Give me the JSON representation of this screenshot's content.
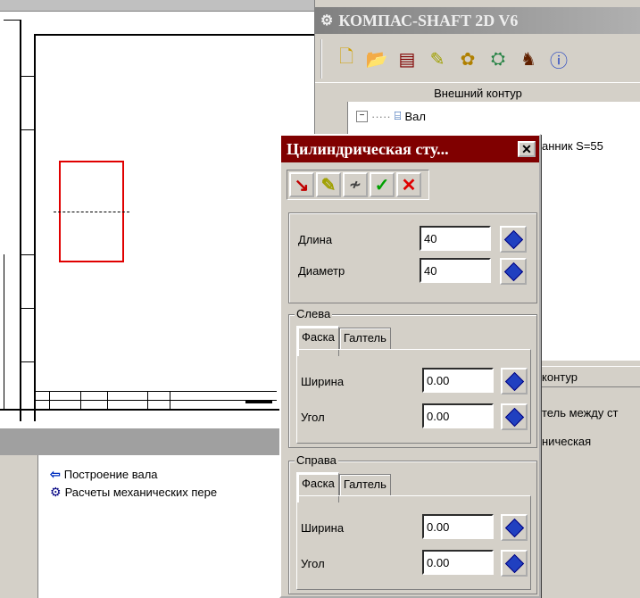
{
  "shaft_window": {
    "title": "КОМПАС-SHAFT 2D V6",
    "toolbar_icons": [
      "new-icon",
      "open-icon",
      "save-icon",
      "wrench-icon",
      "gears-icon",
      "component-icon",
      "calc-icon",
      "info-icon"
    ],
    "outer_contour_header": "Внешний контур",
    "tree": {
      "root": "Вал",
      "child_partial": "анник S=55"
    },
    "inner_contour_header_partial": "контур",
    "lower_text_1": "тель между ст",
    "lower_text_2": "ническая"
  },
  "dialog": {
    "title": "Цилиндрическая сту...",
    "close_label": "✕",
    "toolbar": [
      "sketch-icon",
      "edit-icon",
      "params-icon",
      "ok-icon",
      "cancel-icon"
    ],
    "length_label": "Длина",
    "length_value": "40",
    "diameter_label": "Диаметр",
    "diameter_value": "40",
    "left_group": {
      "title": "Слева",
      "tab_chamfer": "Фаска",
      "tab_fillet": "Галтель",
      "width_label": "Ширина",
      "width_value": "0.00",
      "angle_label": "Угол",
      "angle_value": "0.00"
    },
    "right_group": {
      "title": "Справа",
      "tab_chamfer": "Фаска",
      "tab_fillet": "Галтель",
      "width_label": "Ширина",
      "width_value": "0.00",
      "angle_label": "Угол",
      "angle_value": "0.00"
    }
  },
  "bottom_panel": {
    "items": [
      {
        "icon": "shaft-build-icon",
        "label": "Построение вала"
      },
      {
        "icon": "calc-gear-icon",
        "label": "Расчеты механических пере"
      }
    ]
  },
  "colors": {
    "part_outline": "#e00000",
    "dialog_title_bg": "#800000",
    "window_bg": "#d4d0c8"
  }
}
